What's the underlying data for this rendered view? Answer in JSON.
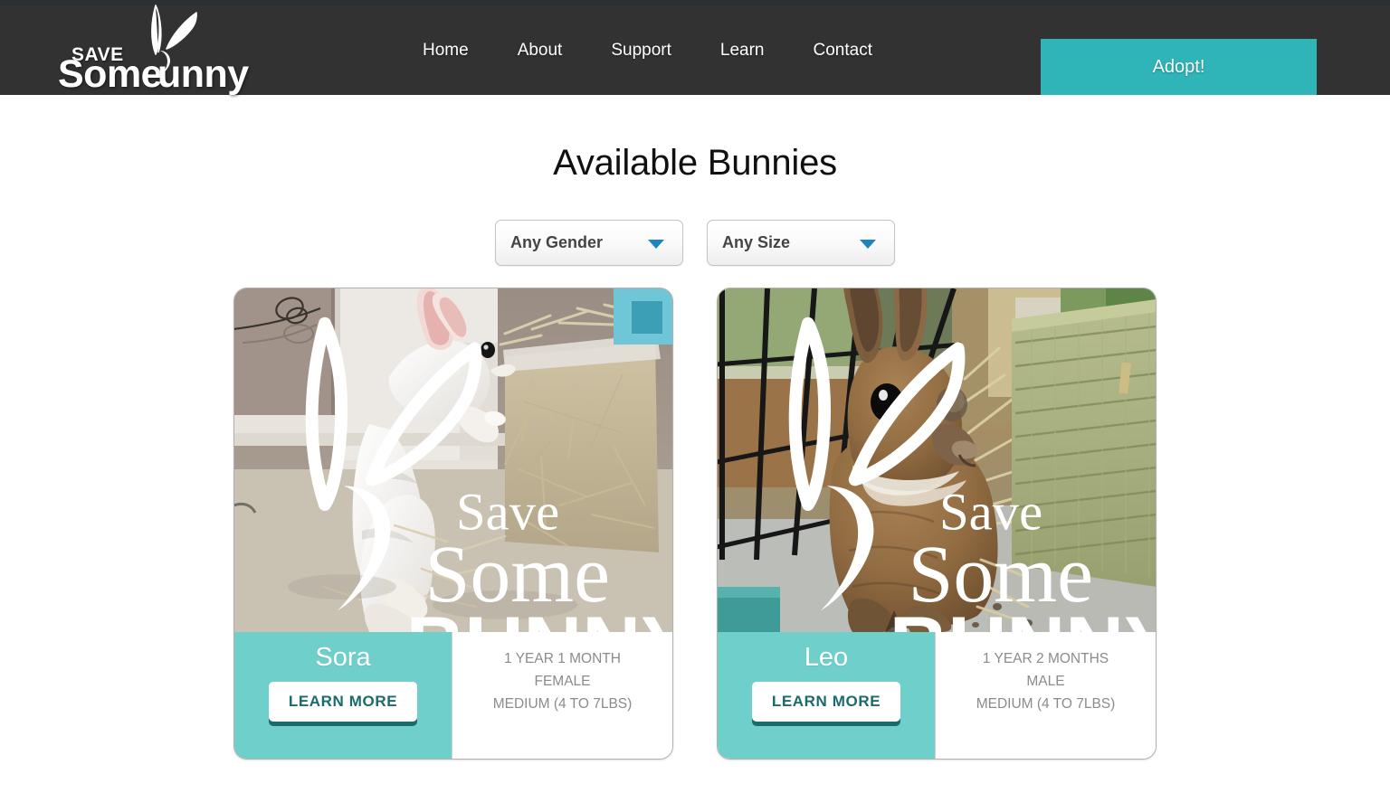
{
  "header": {
    "logo": {
      "save": "SAVE",
      "some": "Some",
      "bunny": "unny",
      "full_text": "SAVE Some Bunny"
    },
    "nav": [
      {
        "label": "Home"
      },
      {
        "label": "About"
      },
      {
        "label": "Support"
      },
      {
        "label": "Learn"
      },
      {
        "label": "Contact"
      }
    ],
    "adopt_label": "Adopt!",
    "colors": {
      "bar": "#323232",
      "top_strip": "#2b2f33",
      "adopt": "#2fb5b7"
    }
  },
  "main": {
    "title": "Available Bunnies",
    "filters": [
      {
        "name": "gender",
        "selected": "Any Gender"
      },
      {
        "name": "size",
        "selected": "Any Size"
      }
    ],
    "filter_arrow_color": "#1f83c0",
    "cards": [
      {
        "name": "Sora",
        "age": "1 YEAR 1 MONTH",
        "gender": "FEMALE",
        "size": "MEDIUM (4 TO 7LBS)",
        "learn_more_label": "LEARN MORE",
        "photo_alt": "white rabbit standing up against a hay box",
        "watermark": {
          "line1": "Save",
          "line2": "Some",
          "line3": "BUNNY"
        }
      },
      {
        "name": "Leo",
        "age": "1 YEAR 2 MONTHS",
        "gender": "MALE",
        "size": "MEDIUM (4 TO 7LBS)",
        "learn_more_label": "LEARN MORE",
        "photo_alt": "brown agouti rabbit in a cage beside a woven grass mat",
        "watermark": {
          "line1": "Save",
          "line2": "Some",
          "line3": "BUNNY"
        }
      }
    ],
    "card_accent_color": "#6ecfcb",
    "learn_more_text_color": "#1b6b6b"
  }
}
